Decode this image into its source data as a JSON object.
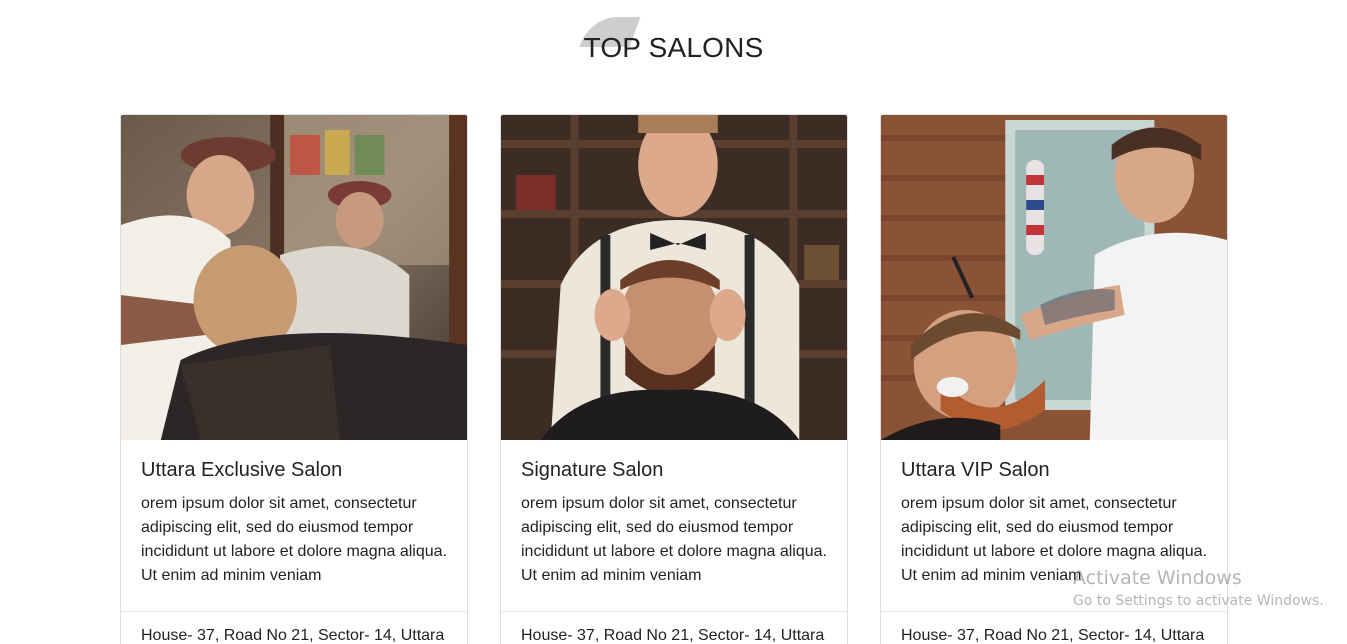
{
  "section": {
    "title": "TOP SALONS"
  },
  "cards": [
    {
      "title": "Uttara Exclusive Salon",
      "description": "orem ipsum dolor sit amet, consectetur adipiscing elit, sed do eiusmod tempor incididunt ut labore et dolore magna aliqua. Ut enim ad minim veniam",
      "address": "House- 37, Road No 21, Sector- 14, Uttara"
    },
    {
      "title": "Signature Salon",
      "description": "orem ipsum dolor sit amet, consectetur adipiscing elit, sed do eiusmod tempor incididunt ut labore et dolore magna aliqua. Ut enim ad minim veniam",
      "address": "House- 37, Road No 21, Sector- 14, Uttara"
    },
    {
      "title": "Uttara VIP Salon",
      "description": "orem ipsum dolor sit amet, consectetur adipiscing elit, sed do eiusmod tempor incididunt ut labore et dolore magna aliqua. Ut enim ad minim veniam",
      "address": "House- 37, Road No 21, Sector- 14, Uttara"
    }
  ],
  "watermark": {
    "title": "Activate Windows",
    "subtitle": "Go to Settings to activate Windows."
  }
}
